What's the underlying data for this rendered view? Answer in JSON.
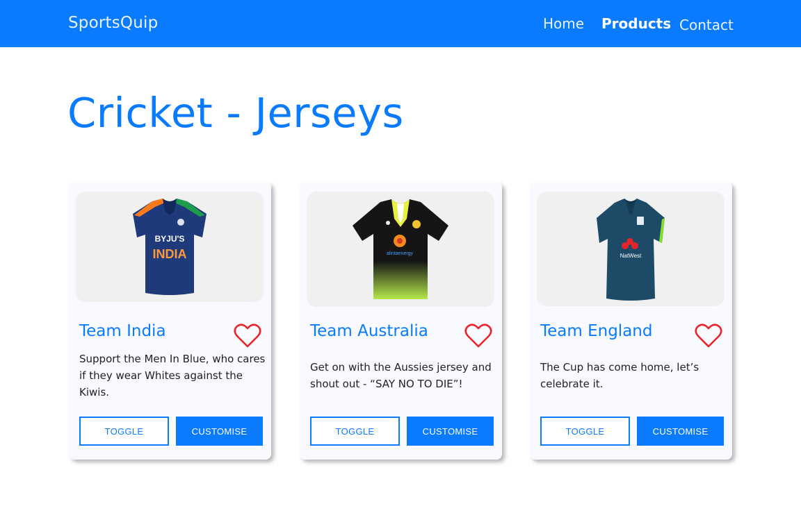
{
  "nav": {
    "brand": "SportsQuip",
    "links": [
      "Home",
      "Products",
      "Contact"
    ]
  },
  "page": {
    "title": "Cricket - Jerseys"
  },
  "colors": {
    "accent": "#0a7bff",
    "heart": "#e8242b",
    "card_bg": "#f8faff"
  },
  "cards": [
    {
      "title": "Team India",
      "description": "Support the Men In Blue, who cares if they wear Whites against the Kiwis.",
      "image_icon": "india-jersey",
      "jersey_text": "BYJU'S INDIA",
      "toggle_label": "TOGGLE",
      "customise_label": "CUSTOMISE"
    },
    {
      "title": "Team Australia",
      "description": "Get on with the Aussies jersey and shout out - “SAY NO TO DIE”!",
      "image_icon": "australia-jersey",
      "jersey_text": "alintaenergy",
      "toggle_label": "TOGGLE",
      "customise_label": "CUSTOMISE"
    },
    {
      "title": "Team England",
      "description": "The Cup has come home, let’s celebrate it.",
      "image_icon": "england-jersey",
      "jersey_text": "NatWest",
      "toggle_label": "TOGGLE",
      "customise_label": "CUSTOMISE"
    }
  ]
}
